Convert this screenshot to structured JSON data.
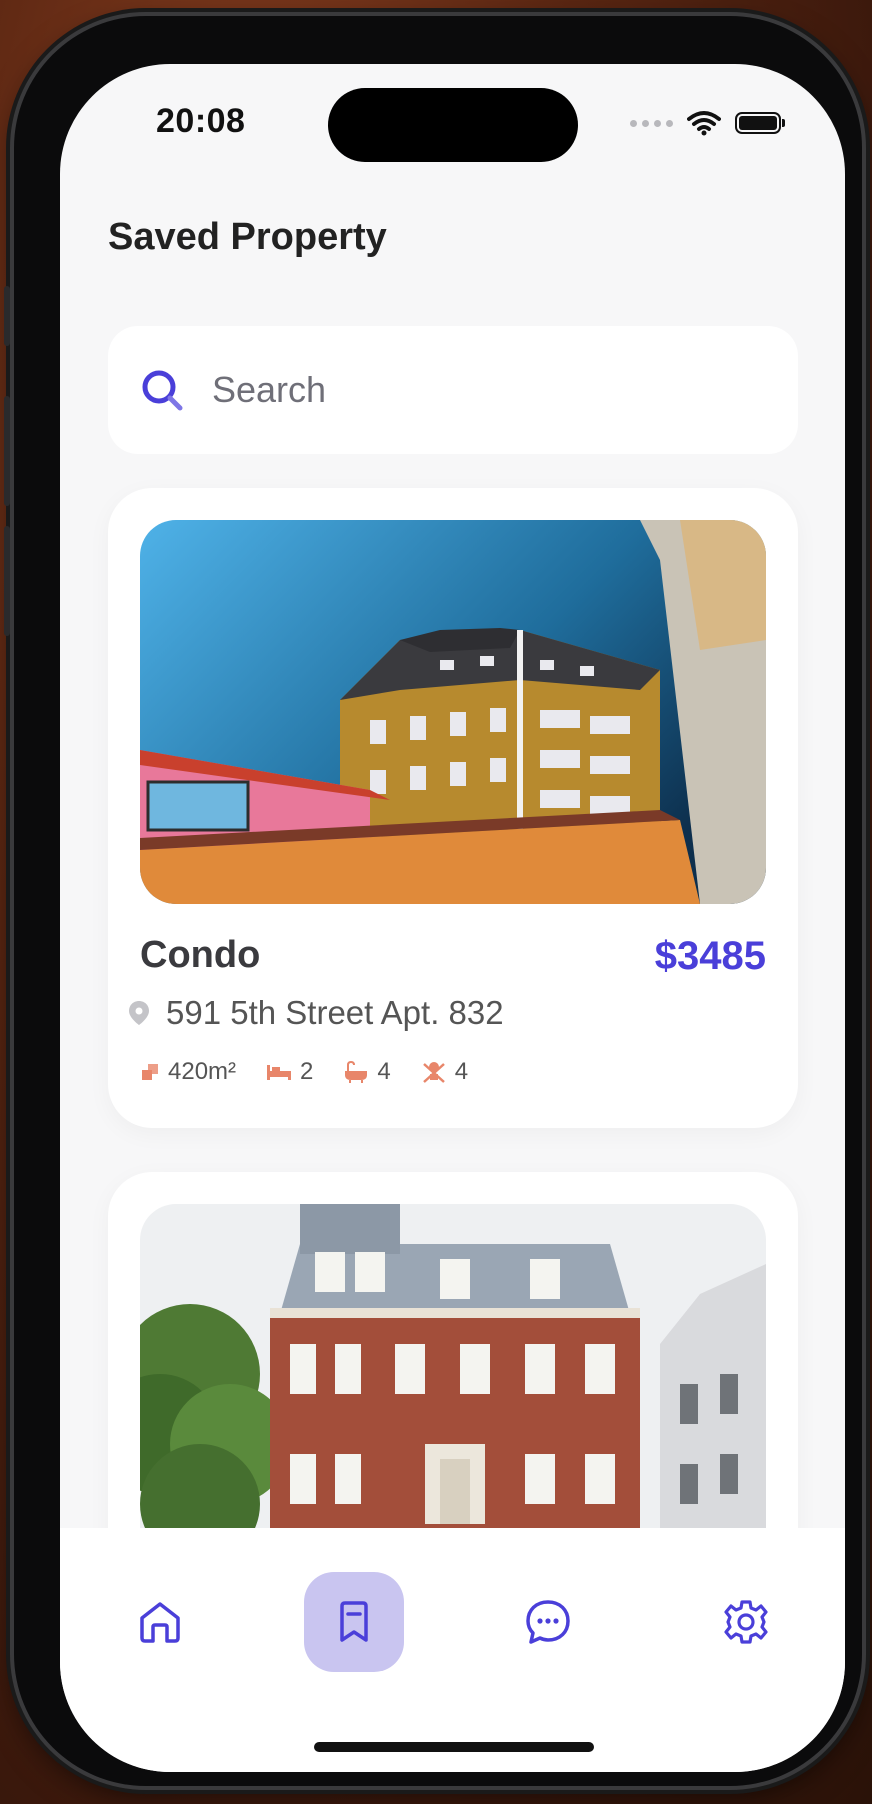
{
  "status_bar": {
    "time": "20:08"
  },
  "header": {
    "title": "Saved Property"
  },
  "search": {
    "placeholder": "Search"
  },
  "properties": [
    {
      "type": "Condo",
      "price": "$3485",
      "address": "591 5th Street Apt. 832",
      "area": "420m²",
      "beds": "2",
      "baths": "4",
      "extra": "4"
    }
  ],
  "tabs": [
    {
      "icon": "home-icon",
      "active": false
    },
    {
      "icon": "bookmark-icon",
      "active": true
    },
    {
      "icon": "chat-icon",
      "active": false
    },
    {
      "icon": "gear-icon",
      "active": false
    }
  ],
  "colors": {
    "accent": "#4a3fd9",
    "accent_soft": "#c9c5f0",
    "feature_icon": "#e8866a"
  }
}
